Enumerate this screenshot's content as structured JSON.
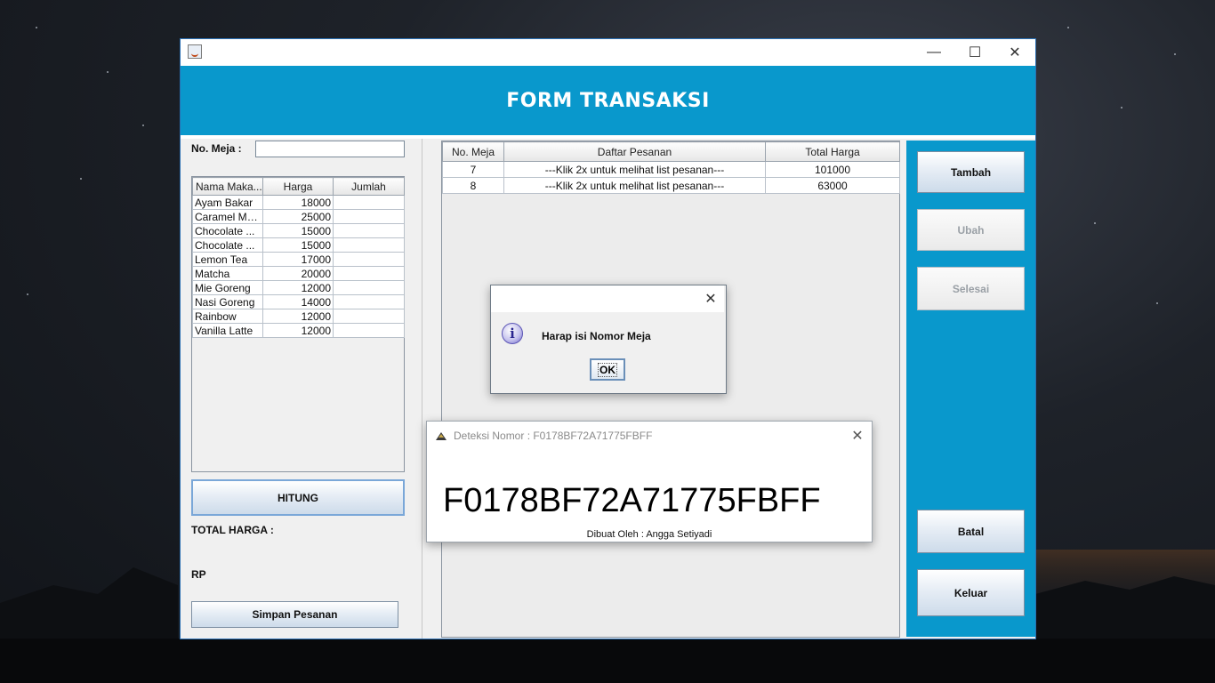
{
  "window": {
    "controls": {
      "minimize": "—",
      "maximize": "☐",
      "close": "✕"
    }
  },
  "header": {
    "title": "FORM TRANSAKSI"
  },
  "left": {
    "meja_label": "No. Meja :",
    "meja_value": "",
    "menu_table": {
      "columns": [
        "Nama Maka...",
        "Harga",
        "Jumlah"
      ],
      "rows": [
        [
          "Ayam Bakar",
          "18000",
          ""
        ],
        [
          "Caramel Ma...",
          "25000",
          ""
        ],
        [
          "Chocolate ...",
          "15000",
          ""
        ],
        [
          "Chocolate ...",
          "15000",
          ""
        ],
        [
          "Lemon Tea",
          "17000",
          ""
        ],
        [
          "Matcha",
          "20000",
          ""
        ],
        [
          "Mie Goreng",
          "12000",
          ""
        ],
        [
          "Nasi Goreng",
          "14000",
          ""
        ],
        [
          "Rainbow",
          "12000",
          ""
        ],
        [
          "Vanilla Latte",
          "12000",
          ""
        ]
      ]
    },
    "hitung_button": "HITUNG",
    "total_label": "TOTAL HARGA :",
    "rp_label": "RP",
    "simpan_button": "Simpan Pesanan"
  },
  "orders": {
    "columns": [
      "No. Meja",
      "Daftar Pesanan",
      "Total Harga"
    ],
    "rows": [
      [
        "7",
        "---Klik 2x untuk melihat list pesanan---",
        "101000"
      ],
      [
        "8",
        "---Klik 2x untuk melihat list pesanan---",
        "63000"
      ]
    ]
  },
  "actions": {
    "tambah": "Tambah",
    "ubah": "Ubah",
    "selesai": "Selesai",
    "batal": "Batal",
    "keluar": "Keluar"
  },
  "dialog": {
    "message": "Harap isi Nomor Meja",
    "ok": "OK",
    "close": "✕",
    "icon": "info-icon"
  },
  "detector": {
    "title": "Deteksi Nomor : F0178BF72A71775FBFF",
    "code": "F0178BF72A71775FBFF",
    "credit": "Dibuat Oleh : Angga Setiyadi",
    "close": "✕"
  },
  "colors": {
    "accent": "#0998cc",
    "window_bg": "#f0f0f0"
  }
}
